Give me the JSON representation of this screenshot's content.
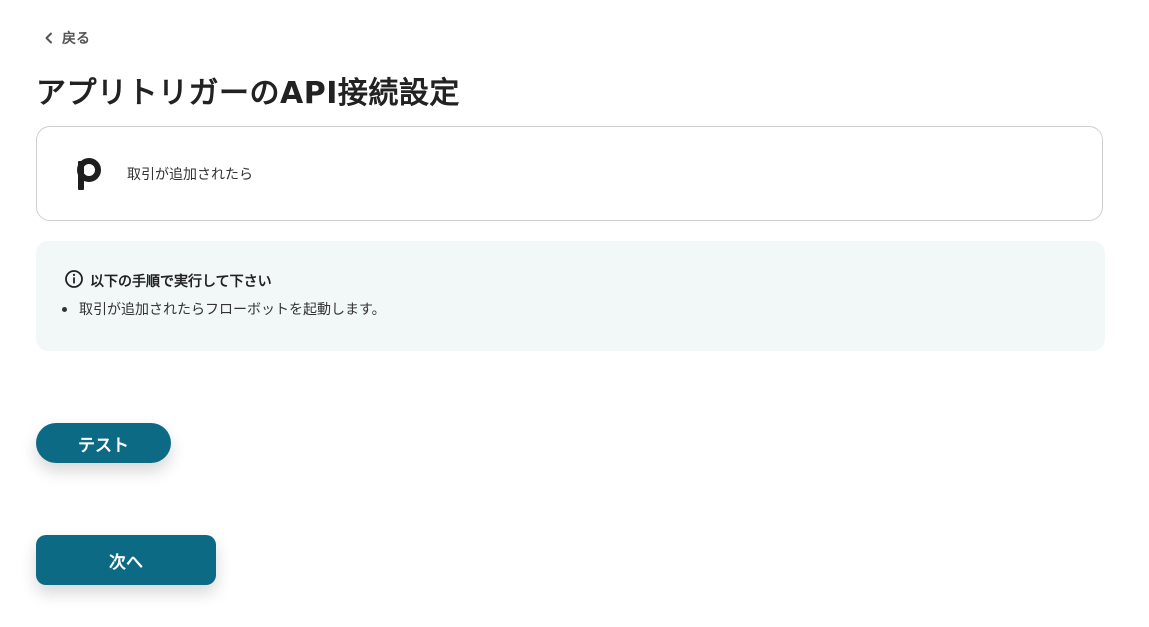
{
  "nav": {
    "back_label": "戻る",
    "back_icon": "chevron-left-icon"
  },
  "page": {
    "title": "アプリトリガーのAPI接続設定"
  },
  "app_card": {
    "logo_icon": "pipedrive-logo",
    "logo_letter": "p",
    "trigger_label": "取引が追加されたら"
  },
  "instructions": {
    "icon": "info-icon",
    "heading": "以下の手順で実行して下さい",
    "items": [
      "取引が追加されたらフローボットを起動します。"
    ]
  },
  "buttons": {
    "test_label": "テスト",
    "next_label": "次へ"
  },
  "colors": {
    "primary": "#0c6a84",
    "info_background": "#f2f8f8",
    "card_border": "#cfcfcf"
  }
}
